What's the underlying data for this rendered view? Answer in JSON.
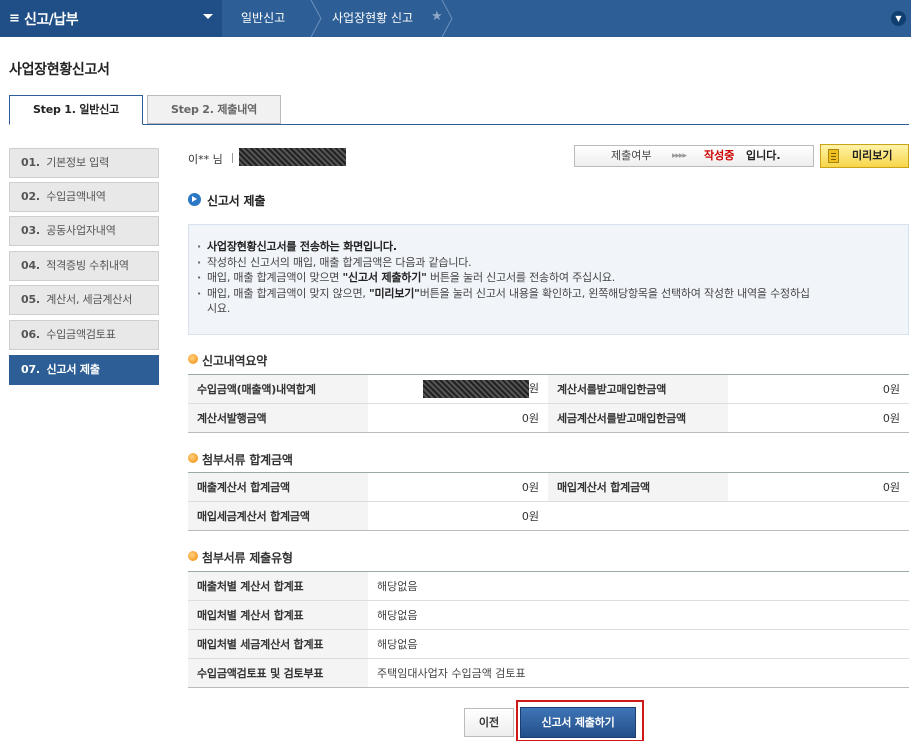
{
  "topbar": {
    "menu_title": "신고/납부",
    "breadcrumbs": [
      "일반신고",
      "사업장현황 신고"
    ]
  },
  "page_title": "사업장현황신고서",
  "tabs": [
    {
      "label": "Step 1. 일반신고",
      "active": true
    },
    {
      "label": "Step 2. 제출내역",
      "active": false
    }
  ],
  "sidebar": {
    "items": [
      {
        "num": "01.",
        "label": "기본정보 입력"
      },
      {
        "num": "02.",
        "label": "수입금액내역"
      },
      {
        "num": "03.",
        "label": "공동사업자내역"
      },
      {
        "num": "04.",
        "label": "적격증빙 수취내역"
      },
      {
        "num": "05.",
        "label": "계산서, 세금계산서"
      },
      {
        "num": "06.",
        "label": "수입금액검토표"
      },
      {
        "num": "07.",
        "label": "신고서 제출"
      }
    ]
  },
  "user": {
    "name": "이** 님"
  },
  "status": {
    "label": "제출여부",
    "arrows": "▸▸▸▸",
    "state": "작성중",
    "suffix": "입니다."
  },
  "preview_button": "미리보기",
  "section_title": "신고서 제출",
  "notice": {
    "line1": "사업장현황신고서를 전송하는 화면입니다.",
    "line2": "작성하신 신고서의 매입, 매출 합계금액은 다음과 같습니다.",
    "line3_a": "매입, 매출 합계금액이 맞으면 ",
    "line3_b": "\"신고서 제출하기\"",
    "line3_c": " 버튼을 눌러 신고서를 전송하여 주십시요.",
    "line4_a": "매입, 매출 합계금액이 맞지 않으면, ",
    "line4_b": "\"미리보기\"",
    "line4_c": "버튼을 눌러 신고서 내용을 확인하고, 왼쪽해당항목을 선택하여 작성한 내역을 수정하십",
    "line5": "시요."
  },
  "summary": {
    "title": "신고내역요약",
    "rows": [
      {
        "label1": "수입금액(매출액)내역합계",
        "value1_suffix": "원",
        "label2": "계산서를받고매입한금액",
        "value2": "0원"
      },
      {
        "label1": "계산서발행금액",
        "value1": "0원",
        "label2": "세금계산서를받고매입한금액",
        "value2": "0원"
      }
    ]
  },
  "attach_totals": {
    "title": "첨부서류 합계금액",
    "rows": [
      {
        "label1": "매출계산서 합계금액",
        "value1": "0원",
        "label2": "매입계산서  합계금액",
        "value2": "0원"
      },
      {
        "label1": "매입세금계산서 합계금액",
        "value1": "0원"
      }
    ]
  },
  "attach_types": {
    "title": "첨부서류 제출유형",
    "rows": [
      {
        "label": "매출처별 계산서 합계표",
        "value": "해당없음"
      },
      {
        "label": "매입처별 계산서 합계표",
        "value": "해당없음"
      },
      {
        "label": "매입처별 세금계산서 합계표",
        "value": "해당없음"
      },
      {
        "label": "수입금액검토표 및 검토부표",
        "value": "주택임대사업자 수입금액 검토표"
      }
    ]
  },
  "buttons": {
    "prev": "이전",
    "submit": "신고서 제출하기"
  },
  "colors": {
    "brand": "#2d5f96",
    "status": "#cc0000",
    "highlight": "#d01818"
  }
}
